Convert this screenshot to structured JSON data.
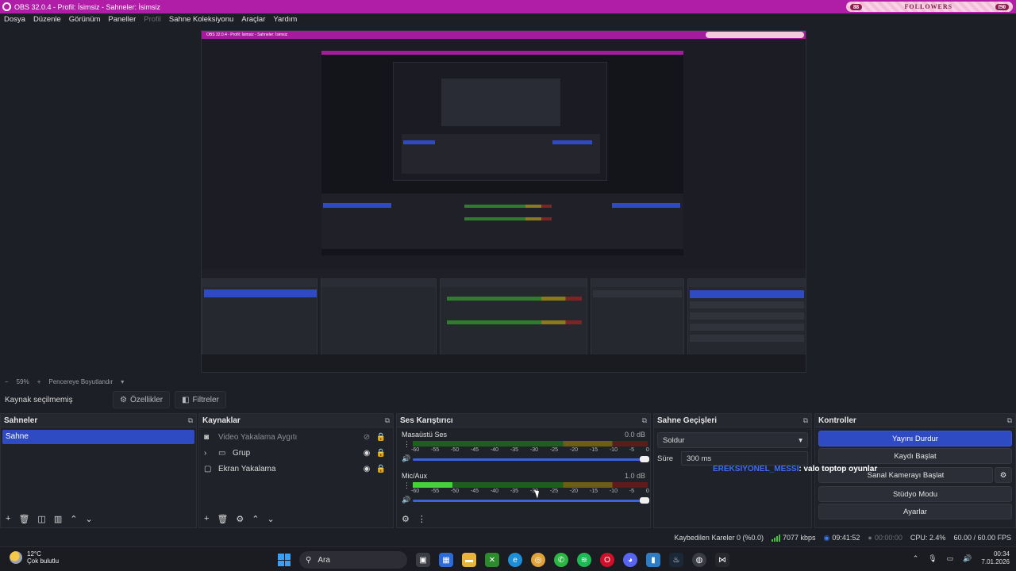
{
  "window": {
    "title": "OBS 32.0.4 - Profil: İsimsiz - Sahneler: İsimsiz",
    "followers_count": "88",
    "followers_label": "FOLLOWERS",
    "followers_goal": "f90"
  },
  "menu": {
    "items": [
      "Dosya",
      "Düzenle",
      "Görünüm",
      "Paneller",
      "Profil",
      "Sahne Koleksiyonu",
      "Araçlar",
      "Yardım"
    ],
    "disabled_index": 4
  },
  "zoom": {
    "value": "59%",
    "mode": "Pencereye Boyutlandır"
  },
  "source_toolbar": {
    "no_selection": "Kaynak seçilmemiş",
    "properties": "Özellikler",
    "filters": "Filtreler"
  },
  "scenes": {
    "title": "Sahneler",
    "items": [
      "Sahne"
    ]
  },
  "sources": {
    "title": "Kaynaklar",
    "items": [
      {
        "name": "Video Yakalama Aygıtı",
        "icon": "camera-icon",
        "hidden": true
      },
      {
        "name": "Grup",
        "icon": "folder-icon",
        "hidden": false
      },
      {
        "name": "Ekran Yakalama",
        "icon": "monitor-icon",
        "hidden": false
      }
    ]
  },
  "mixer": {
    "title": "Ses Karıştırıcı",
    "ticks": [
      "-60",
      "-55",
      "-50",
      "-45",
      "-40",
      "-35",
      "-30",
      "-25",
      "-20",
      "-15",
      "-10",
      "-5",
      "0"
    ],
    "channels": [
      {
        "name": "Masaüstü Ses",
        "db": "0.0 dB",
        "level": 0.0,
        "volume": 1.0
      },
      {
        "name": "Mic/Aux",
        "db": "1.0 dB",
        "level": 0.17,
        "volume": 1.0
      }
    ]
  },
  "transitions": {
    "title": "Sahne Geçişleri",
    "selected": "Soldur",
    "duration_label": "Süre",
    "duration": "300 ms"
  },
  "controls": {
    "title": "Kontroller",
    "buttons": [
      "Yayını Durdur",
      "Kaydı Başlat",
      "Sanal Kamerayı Başlat",
      "Stüdyo Modu",
      "Ayarlar"
    ]
  },
  "chat": {
    "user": "EREKSIYONEL_MESSI",
    "message": ": valo toptop oyunlar"
  },
  "status": {
    "dropped": "Kaybedilen Kareler 0 (%0.0)",
    "bitrate": "7077 kbps",
    "stream_time": "09:41:52",
    "record_time": "00:00:00",
    "cpu": "CPU: 2.4%",
    "fps": "60.00 / 60.00 FPS"
  },
  "taskbar": {
    "temp": "12°C",
    "weather": "Çok bulutlu",
    "search": "Ara",
    "time": "00:34",
    "date": "7.01.2026"
  },
  "colors": {
    "accent": "#2f4bc4",
    "titlebar": "#b01ea8"
  }
}
